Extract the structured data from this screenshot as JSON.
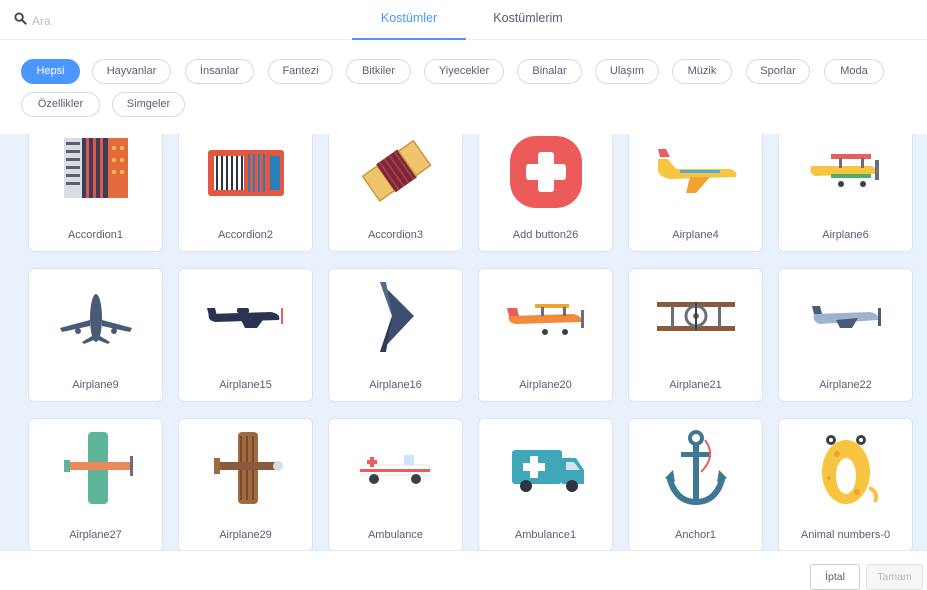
{
  "search": {
    "placeholder": "Ara",
    "icon": "search-icon"
  },
  "tabs": [
    {
      "label": "Kostümler",
      "active": true
    },
    {
      "label": "Kostümlerim",
      "active": false
    }
  ],
  "filters": [
    {
      "label": "Hepsi",
      "active": true
    },
    {
      "label": "Hayvanlar"
    },
    {
      "label": "İnsanlar"
    },
    {
      "label": "Fantezi"
    },
    {
      "label": "Bitkiler"
    },
    {
      "label": "Yiyecekler"
    },
    {
      "label": "Binalar"
    },
    {
      "label": "Ulaşım"
    },
    {
      "label": "Müzik"
    },
    {
      "label": "Sporlar"
    },
    {
      "label": "Moda"
    },
    {
      "label": "Özellikler"
    },
    {
      "label": "Simgeler"
    }
  ],
  "costumes": [
    {
      "label": "Accordion1",
      "icon": "accordion-icon"
    },
    {
      "label": "Accordion2",
      "icon": "accordion-icon"
    },
    {
      "label": "Accordion3",
      "icon": "accordion-icon"
    },
    {
      "label": "Add button26",
      "icon": "add-button-icon"
    },
    {
      "label": "Airplane4",
      "icon": "airplane-icon"
    },
    {
      "label": "Airplane6",
      "icon": "biplane-icon"
    },
    {
      "label": "Airplane9",
      "icon": "jet-icon"
    },
    {
      "label": "Airplane15",
      "icon": "fighter-plane-icon"
    },
    {
      "label": "Airplane16",
      "icon": "stealth-bomber-icon"
    },
    {
      "label": "Airplane20",
      "icon": "biplane-icon"
    },
    {
      "label": "Airplane21",
      "icon": "biplane-icon"
    },
    {
      "label": "Airplane22",
      "icon": "airplane-icon"
    },
    {
      "label": "Airplane27",
      "icon": "biplane-topdown-icon"
    },
    {
      "label": "Airplane29",
      "icon": "biplane-topdown-icon"
    },
    {
      "label": "Ambulance",
      "icon": "ambulance-icon"
    },
    {
      "label": "Ambulance1",
      "icon": "ambulance-icon"
    },
    {
      "label": "Anchor1",
      "icon": "anchor-icon"
    },
    {
      "label": "Animal numbers-0",
      "icon": "animal-number-zero-icon"
    }
  ],
  "footer": {
    "cancel_label": "İptal",
    "done_label": "Tamam"
  },
  "colors": {
    "accent": "#4c97ff",
    "grid_background": "#e9f1fc",
    "text": "#575e75"
  }
}
